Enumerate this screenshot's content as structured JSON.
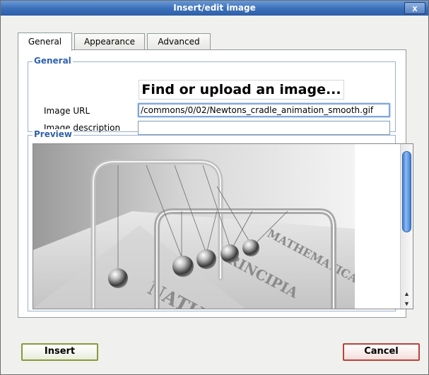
{
  "dialog": {
    "title": "Insert/edit image",
    "close_label": "x"
  },
  "tabs": [
    {
      "label": "General",
      "active": true
    },
    {
      "label": "Appearance",
      "active": false
    },
    {
      "label": "Advanced",
      "active": false
    }
  ],
  "general": {
    "legend": "General",
    "find_upload_label": "Find or upload an image...",
    "image_url_label": "Image URL",
    "image_url_value": "/commons/0/02/Newtons_cradle_animation_smooth.gif",
    "image_description_label": "Image description",
    "image_description_value": ""
  },
  "preview": {
    "legend": "Preview",
    "book_words": [
      "NATURALIS",
      "PRINCIPIA",
      "MATHEMATICA"
    ]
  },
  "buttons": {
    "insert_label": "Insert",
    "cancel_label": "Cancel"
  },
  "colors": {
    "accent": "#2f62ad",
    "insert_border": "#8a9a3a",
    "cancel_border": "#b9443a"
  }
}
